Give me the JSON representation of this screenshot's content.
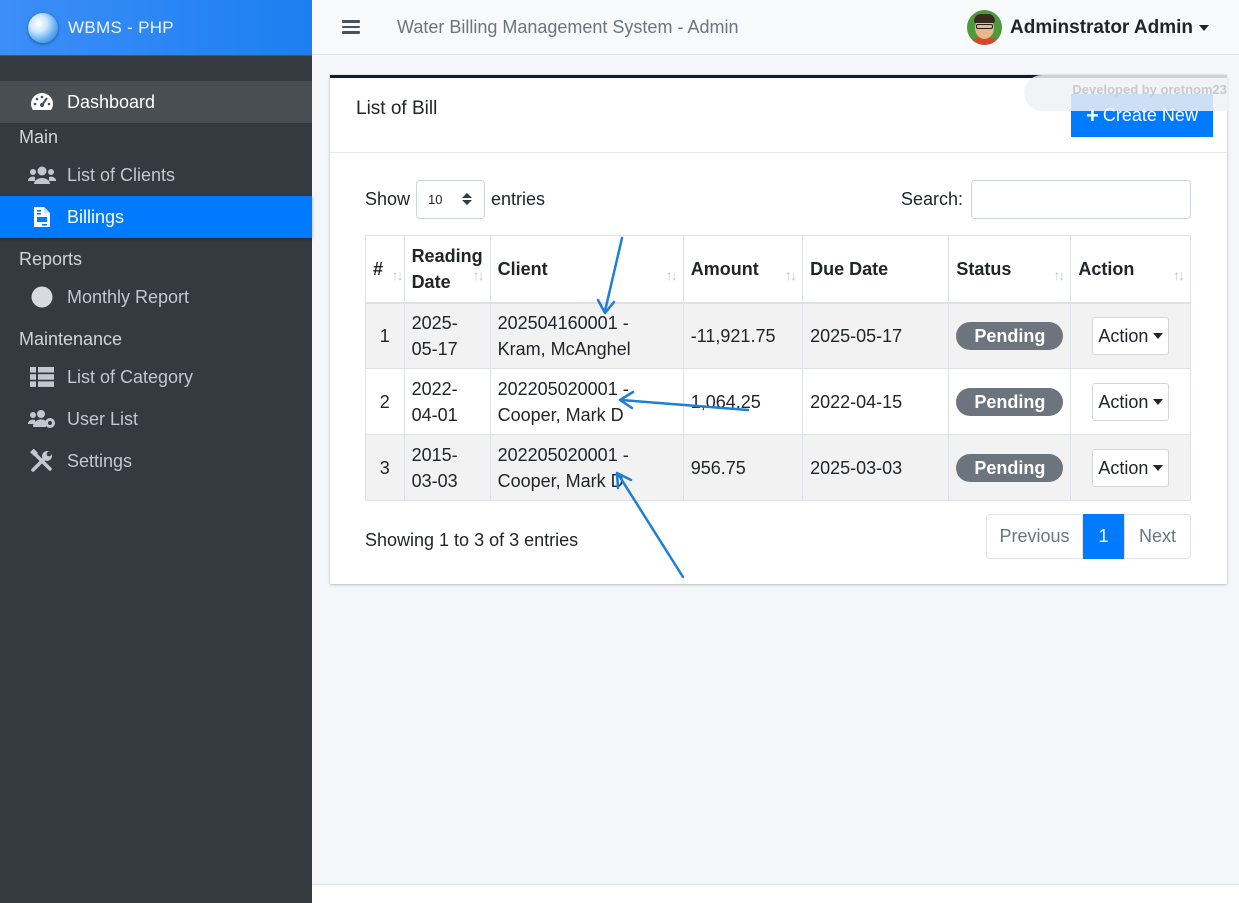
{
  "brand": {
    "title": "WBMS - PHP"
  },
  "sidebar": {
    "dashboard": "Dashboard",
    "sections": [
      {
        "header": "Main",
        "items": [
          "List of Clients",
          "Billings"
        ]
      },
      {
        "header": "Reports",
        "items": [
          "Monthly Report"
        ]
      },
      {
        "header": "Maintenance",
        "items": [
          "List of Category",
          "User List",
          "Settings"
        ]
      }
    ],
    "active_item": "Billings"
  },
  "topbar": {
    "title": "Water Billing Management System - Admin",
    "user_name": "Adminstrator Admin"
  },
  "card": {
    "title": "List of Bill",
    "create_button": "Create New",
    "watermark": "Developed by oretnom23"
  },
  "controls": {
    "show_label": "Show",
    "entries_value": "10",
    "entries_label": "entries",
    "search_label": "Search:",
    "search_value": ""
  },
  "table": {
    "columns": [
      "#",
      "Reading Date",
      "Client",
      "Amount",
      "Due Date",
      "Status",
      "Action"
    ],
    "rows": [
      {
        "num": "1",
        "reading_date": "2025-05-17",
        "client": "202504160001 - Kram, McAnghel",
        "amount": "-11,921.75",
        "due_date": "2025-05-17",
        "status": "Pending",
        "action": "Action"
      },
      {
        "num": "2",
        "reading_date": "2022-04-01",
        "client": "202205020001 - Cooper, Mark D",
        "amount": "1,064.25",
        "due_date": "2022-04-15",
        "status": "Pending",
        "action": "Action"
      },
      {
        "num": "3",
        "reading_date": "2015-03-03",
        "client": "202205020001 - Cooper, Mark D",
        "amount": "956.75",
        "due_date": "2025-03-03",
        "status": "Pending",
        "action": "Action"
      }
    ]
  },
  "pagination": {
    "info": "Showing 1 to 3 of 3 entries",
    "previous": "Previous",
    "current": "1",
    "next": "Next"
  },
  "colors": {
    "primary": "#007bff",
    "sidebar_bg": "#343a40",
    "badge_pending": "#6c757d",
    "annotation_arrow": "#1e7fd6"
  }
}
